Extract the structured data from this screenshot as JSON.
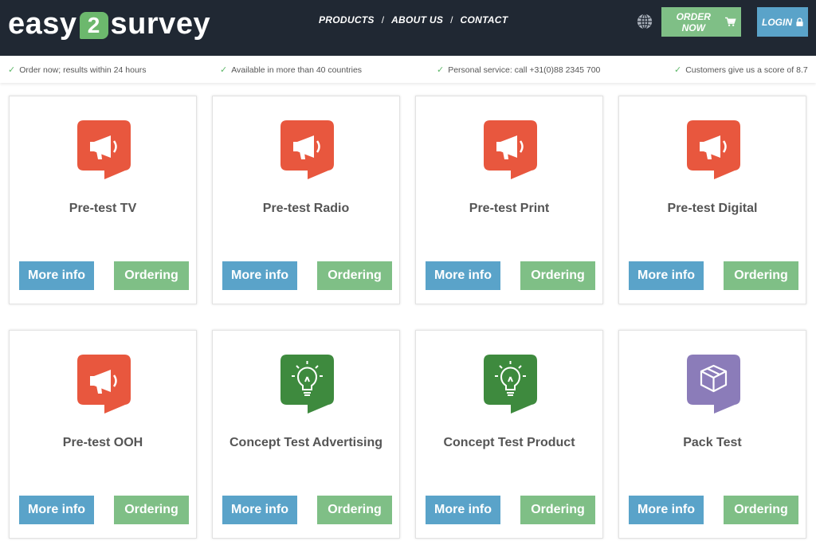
{
  "logo": {
    "part1": "easy",
    "part2": "2",
    "part3": "survey"
  },
  "nav": {
    "products": "PRODUCTS",
    "about": "ABOUT US",
    "contact": "CONTACT",
    "separator": "/"
  },
  "header_buttons": {
    "order_now": "ORDER NOW",
    "login": "LOGIN"
  },
  "usps": [
    "Order now; results within 24 hours",
    "Available in more than 40 countries",
    "Personal service: call +31(0)88 2345 700",
    "Customers give us a score of 8.7"
  ],
  "cards": [
    {
      "title": "Pre-test TV",
      "icon": "megaphone-icon",
      "color": "#e8573e"
    },
    {
      "title": "Pre-test Radio",
      "icon": "megaphone-icon",
      "color": "#e8573e"
    },
    {
      "title": "Pre-test Print",
      "icon": "megaphone-icon",
      "color": "#e8573e"
    },
    {
      "title": "Pre-test Digital",
      "icon": "megaphone-icon",
      "color": "#e8573e"
    },
    {
      "title": "Pre-test OOH",
      "icon": "megaphone-icon",
      "color": "#e8573e"
    },
    {
      "title": "Concept Test Advertising",
      "icon": "lightbulb-icon",
      "color": "#3e8a3e"
    },
    {
      "title": "Concept Test Product",
      "icon": "lightbulb-icon",
      "color": "#3e8a3e"
    },
    {
      "title": "Pack Test",
      "icon": "box-icon",
      "color": "#8b7cb9"
    }
  ],
  "card_buttons": {
    "more_info": "More info",
    "ordering": "Ordering"
  },
  "colors": {
    "header_bg": "#202833",
    "green": "#7fbf86",
    "blue": "#5aa3c9"
  }
}
